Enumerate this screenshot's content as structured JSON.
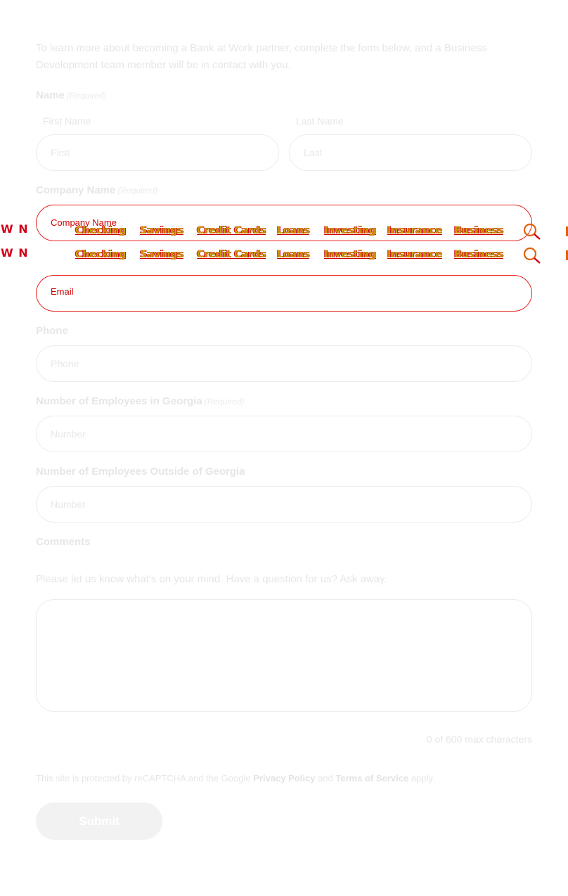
{
  "intro_text": "To learn more about becoming a Bank at Work partner, complete the form below, and a Business Development team member will be in contact with you.",
  "name_field": {
    "label": "Name",
    "required": "(Required)",
    "first_label": "First Name",
    "first_placeholder": "First",
    "last_label": "Last Name",
    "last_placeholder": "Last"
  },
  "company_field": {
    "label": "Company Name",
    "required": "(Required)",
    "placeholder": "Company Name"
  },
  "email_field": {
    "placeholder": "Email"
  },
  "phone_field": {
    "label": "Phone",
    "placeholder": "Phone"
  },
  "employees_ga_field": {
    "label": "Number of Employees in Georgia",
    "required": "(Required)",
    "placeholder": "Number"
  },
  "employees_out_field": {
    "label": "Number of Employees Outside of Georgia",
    "placeholder": "Number"
  },
  "comments_field": {
    "label": "Comments",
    "hint": "Please let us know what's on your mind. Have a question for us? Ask away.",
    "counter": "0 of 600 max characters"
  },
  "recaptcha": {
    "prefix": "This site is protected by reCAPTCHA and the Google",
    "privacy": "Privacy Policy",
    "and": "and",
    "terms": "Terms of Service",
    "suffix": "apply."
  },
  "submit_label": "Submit",
  "nav": {
    "logo": "W N",
    "items": [
      "Checking",
      "Savings",
      "Credit Cards",
      "Loans",
      "Investing",
      "Insurance",
      "Business"
    ]
  },
  "icons": {
    "search": "search-icon"
  },
  "colors": {
    "accent_red": "#d0021b",
    "accent_yellow": "#c8a000",
    "accent_orange": "#e36000"
  }
}
